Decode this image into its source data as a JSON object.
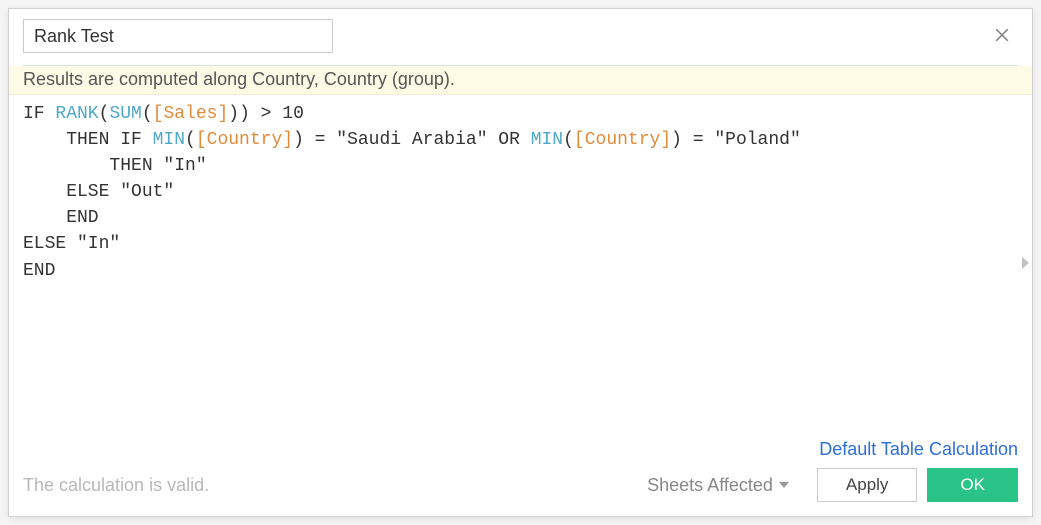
{
  "header": {
    "name_value": "Rank Test"
  },
  "results_message": "Results are computed along Country, Country (group).",
  "code": {
    "line1_if": "IF ",
    "line1_rank": "RANK",
    "line1_paren1": "(",
    "line1_sum": "SUM",
    "line1_paren2": "(",
    "line1_sales": "[Sales]",
    "line1_rest": ")) > 10",
    "line2_pre": "    THEN IF ",
    "line2_min1": "MIN",
    "line2_p1": "(",
    "line2_country1": "[Country]",
    "line2_mid": ") = \"Saudi Arabia\" OR ",
    "line2_min2": "MIN",
    "line2_p2": "(",
    "line2_country2": "[Country]",
    "line2_end": ") = \"Poland\"",
    "line3": "        THEN \"In\"",
    "line4": "    ELSE \"Out\"",
    "line5": "    END",
    "line6": "ELSE \"In\"",
    "line7": "END"
  },
  "footer": {
    "default_calc_link": "Default Table Calculation",
    "status": "The calculation is valid.",
    "sheets_affected": "Sheets Affected",
    "apply_label": "Apply",
    "ok_label": "OK"
  }
}
